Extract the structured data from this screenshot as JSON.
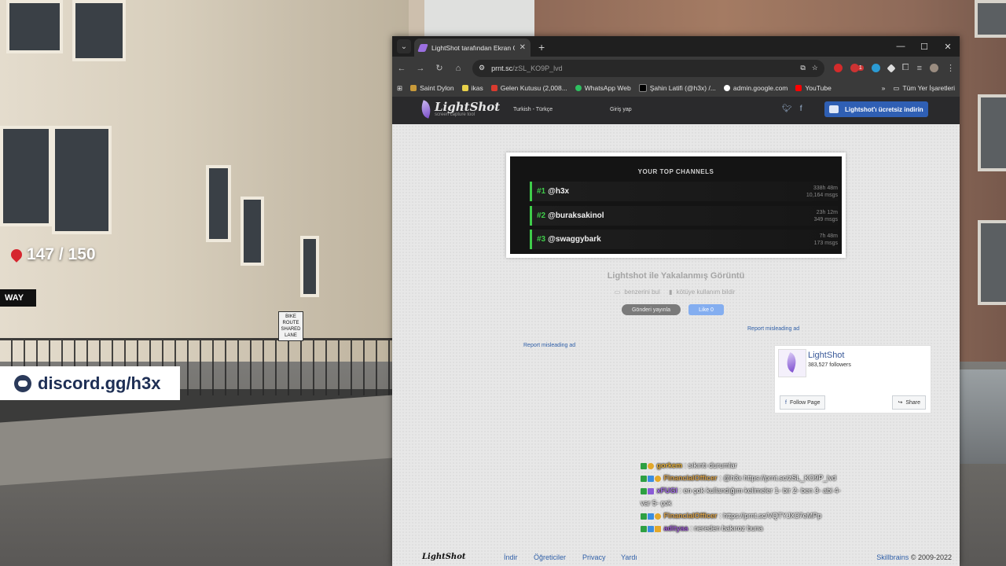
{
  "overlay": {
    "counter": "147 / 150",
    "discord": "discord.gg/h3x",
    "one_way": "WAY",
    "bike_sign": "BIKE ROUTE SHARED LANE"
  },
  "browser": {
    "tab_title": "LightShot tarafından Ekran Görü",
    "url_host": "prnt.sc",
    "url_path": "/zSL_KO9P_lvd",
    "bookmarks": [
      "Saint Dylon",
      "ikas",
      "Gelen Kutusu (2,008...",
      "WhatsApp Web",
      "Şahin Latifi (@h3x) /...",
      "admin.google.com",
      "YouTube"
    ],
    "bookmarks_more": "»",
    "all_bookmarks": "Tüm Yer İşaretleri",
    "ext_badge": "1"
  },
  "lightshot": {
    "logo": "LightShot",
    "logo_tag": "screen capture tool",
    "language": "Turkish - Türkçe",
    "login": "Giriş yap",
    "download": "Lightshot'ı ücretsiz indirin",
    "caption": "Lightshot ile Yakalanmış Görüntü",
    "find_similar": "benzerini bul",
    "report_abuse": "kötüye kullanım bildir",
    "x_share": "Gönderi yayınla",
    "fb_like": "Like 0",
    "report_ad_1": "Report misleading ad",
    "report_ad_2": "Report misleading ad",
    "fb_page_name": "LightShot",
    "fb_followers": "383,527 followers",
    "fb_follow": "Follow Page",
    "fb_share": "Share"
  },
  "screenshot": {
    "title": "YOUR TOP CHANNELS",
    "channels": [
      {
        "rank": "#1",
        "name": "@h3x",
        "time": "338h 48m",
        "msgs": "10,164 msgs"
      },
      {
        "rank": "#2",
        "name": "@buraksakinol",
        "time": "23h 12m",
        "msgs": "349 msgs"
      },
      {
        "rank": "#3",
        "name": "@swaggybark",
        "time": "7h 48m",
        "msgs": "173 msgs"
      }
    ]
  },
  "footer": {
    "logo": "LightShot",
    "links": [
      "İndir",
      "Öğreticiler",
      "Privacy",
      "Yardı"
    ],
    "brand": "Skillbrains",
    "copyright": "© 2009-2022"
  },
  "chat": [
    {
      "user": "gorkem",
      "msg": ": sıkıntı durumlar"
    },
    {
      "user": "FinancialOfficer",
      "msg": ": @h3x https://prnt.sc/zSL_KO9P_lvd"
    },
    {
      "user": "xFUGI",
      "msg": ": en çok kullandığım kelimeler 1- bir 2- ben 3- abi 4- var 5- çok"
    },
    {
      "user": "FinancialOfficer",
      "msg": ": https://prnt.sc/VQTYJX37eMPp"
    },
    {
      "user": "adityaa",
      "msg": ": nereden bakıroz buna"
    }
  ],
  "colors": {
    "accent_green": "#3fcc4a",
    "lightshot_blue": "#2f5fb4",
    "discord_navy": "#1e2f55"
  }
}
